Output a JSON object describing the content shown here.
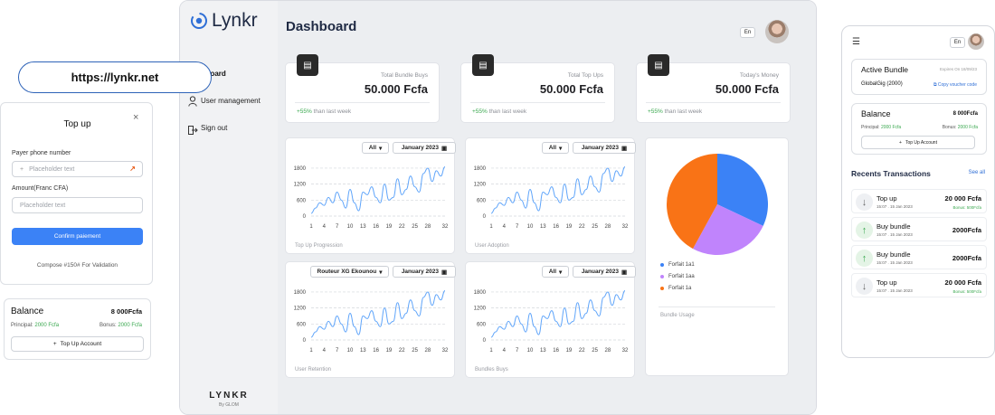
{
  "url_bar": {
    "text": "https://lynkr.net"
  },
  "topup_modal": {
    "title": "Top up",
    "phone_label": "Payer phone number",
    "phone_placeholder": "Placeholder text",
    "amount_label": "Amount(Franc CFA)",
    "amount_placeholder": "Placeholder text",
    "confirm_label": "Confirm paiement",
    "footer_text": "Compose #150# For Validation"
  },
  "left_balance": {
    "title": "Balance",
    "amount": "8 000Fcfa",
    "principal_label": "Principal:",
    "principal_value": "2000 Fcfa",
    "bonus_label": "Bonus:",
    "bonus_value": "2000 Fcfa",
    "topup_button": "Top Up Account"
  },
  "dashboard": {
    "logo": "Lynkr",
    "title": "Dashboard",
    "lang": "En",
    "nav": [
      {
        "label": "Dashboard"
      },
      {
        "label": "User management"
      },
      {
        "label": "Sign out"
      }
    ],
    "footer_brand": "LYNKR",
    "footer_sub": "By GLOM",
    "stats": [
      {
        "label": "Total Bundle Buys",
        "value": "50.000 Fcfa",
        "delta": "+55%",
        "delta_text": "than last week"
      },
      {
        "label": "Total Top Ups",
        "value": "50.000 Fcfa",
        "delta": "+55%",
        "delta_text": "than last week"
      },
      {
        "label": "Today's Money",
        "value": "50.000 Fcfa",
        "delta": "+55%",
        "delta_text": "than last week"
      }
    ],
    "charts_ui": [
      {
        "filter": "All",
        "date": "January 2023",
        "caption": "Top Up Progression"
      },
      {
        "filter": "All",
        "date": "January 2023",
        "caption": "User Adoption"
      },
      {
        "filter": "Routeur XG Ekounou",
        "date": "January 2023",
        "caption": "User Retention"
      },
      {
        "filter": "All",
        "date": "January 2023",
        "caption": "Bundles Buys"
      }
    ],
    "pie_ui": {
      "caption": "Bundle Usage"
    }
  },
  "chart_data": [
    {
      "type": "line",
      "title": "Top Up Progression",
      "x": [
        1,
        2,
        3,
        4,
        5,
        6,
        7,
        8,
        9,
        10,
        11,
        12,
        13,
        14,
        15,
        16,
        17,
        18,
        19,
        20,
        21,
        22,
        23,
        24,
        25,
        26,
        27,
        28,
        29,
        30,
        31,
        32
      ],
      "y": [
        100,
        300,
        500,
        400,
        700,
        500,
        900,
        600,
        300,
        1000,
        500,
        200,
        900,
        800,
        1100,
        700,
        500,
        1200,
        600,
        700,
        1400,
        800,
        1000,
        1500,
        1100,
        900,
        1600,
        1800,
        1300,
        1700,
        1500,
        1850
      ],
      "xticks": [
        1,
        4,
        7,
        10,
        13,
        16,
        19,
        22,
        25,
        28,
        32
      ],
      "yticks": [
        0,
        600,
        1200,
        1800
      ],
      "ylim": [
        0,
        1900
      ]
    },
    {
      "type": "line",
      "title": "User Adoption",
      "x": [
        1,
        2,
        3,
        4,
        5,
        6,
        7,
        8,
        9,
        10,
        11,
        12,
        13,
        14,
        15,
        16,
        17,
        18,
        19,
        20,
        21,
        22,
        23,
        24,
        25,
        26,
        27,
        28,
        29,
        30,
        31,
        32
      ],
      "y": [
        100,
        300,
        500,
        400,
        700,
        500,
        900,
        600,
        300,
        1000,
        500,
        200,
        900,
        800,
        1100,
        700,
        500,
        1200,
        600,
        700,
        1400,
        800,
        1000,
        1500,
        1100,
        900,
        1600,
        1800,
        1300,
        1700,
        1500,
        1850
      ],
      "xticks": [
        1,
        4,
        7,
        10,
        13,
        16,
        19,
        22,
        25,
        28,
        32
      ],
      "yticks": [
        0,
        600,
        1200,
        1800
      ],
      "ylim": [
        0,
        1900
      ]
    },
    {
      "type": "line",
      "title": "User Retention",
      "x": [
        1,
        2,
        3,
        4,
        5,
        6,
        7,
        8,
        9,
        10,
        11,
        12,
        13,
        14,
        15,
        16,
        17,
        18,
        19,
        20,
        21,
        22,
        23,
        24,
        25,
        26,
        27,
        28,
        29,
        30,
        31,
        32
      ],
      "y": [
        100,
        300,
        500,
        400,
        700,
        500,
        900,
        600,
        300,
        1000,
        500,
        200,
        900,
        800,
        1100,
        700,
        500,
        1200,
        600,
        700,
        1400,
        800,
        1000,
        1500,
        1100,
        900,
        1600,
        1800,
        1300,
        1700,
        1500,
        1850
      ],
      "xticks": [
        1,
        4,
        7,
        10,
        13,
        16,
        19,
        22,
        25,
        28,
        32
      ],
      "yticks": [
        0,
        600,
        1200,
        1800
      ],
      "ylim": [
        0,
        1900
      ]
    },
    {
      "type": "line",
      "title": "Bundles Buys",
      "x": [
        1,
        2,
        3,
        4,
        5,
        6,
        7,
        8,
        9,
        10,
        11,
        12,
        13,
        14,
        15,
        16,
        17,
        18,
        19,
        20,
        21,
        22,
        23,
        24,
        25,
        26,
        27,
        28,
        29,
        30,
        31,
        32
      ],
      "y": [
        100,
        300,
        500,
        400,
        700,
        500,
        900,
        600,
        300,
        1000,
        500,
        200,
        900,
        800,
        1100,
        700,
        500,
        1200,
        600,
        700,
        1400,
        800,
        1000,
        1500,
        1100,
        900,
        1600,
        1800,
        1300,
        1700,
        1500,
        1850
      ],
      "xticks": [
        1,
        4,
        7,
        10,
        13,
        16,
        19,
        22,
        25,
        28,
        32
      ],
      "yticks": [
        0,
        600,
        1200,
        1800
      ],
      "ylim": [
        0,
        1900
      ]
    },
    {
      "type": "pie",
      "title": "Bundle Usage",
      "categories": [
        "Forfait 1a1",
        "Forfait 1aa",
        "Forfait 1a"
      ],
      "values": [
        32,
        26,
        42
      ],
      "colors": [
        "#3b82f6",
        "#c084fc",
        "#f97316"
      ]
    }
  ],
  "phone": {
    "lang": "En",
    "active_bundle": {
      "title": "Active Bundle",
      "expires": "Expires On 18/09/23",
      "name": "GlobalGig (2000)",
      "copy_label": "Copy voucher code"
    },
    "balance": {
      "title": "Balance",
      "amount": "8 000Fcfa",
      "principal_label": "Principal:",
      "principal_value": "2000 Fcfa",
      "bonus_label": "Bonus:",
      "bonus_value": "2000 Fcfa",
      "topup_button": "Top Up Account"
    },
    "recents_title": "Recents Transactions",
    "see_all": "See all",
    "transactions": [
      {
        "title": "Top up",
        "date": "15:07 . 15 Jan 2023",
        "amount": "20 000 Fcfa",
        "bonus": "Bonus: 500Fcfa",
        "direction": "down"
      },
      {
        "title": "Buy bundle",
        "date": "15:07 . 15 Jan 2023",
        "amount": "2000Fcfa",
        "bonus": "",
        "direction": "up"
      },
      {
        "title": "Buy bundle",
        "date": "15:07 . 15 Jan 2023",
        "amount": "2000Fcfa",
        "bonus": "",
        "direction": "up"
      },
      {
        "title": "Top up",
        "date": "15:07 . 15 Jan 2023",
        "amount": "20 000 Fcfa",
        "bonus": "Bonus: 500Fcfa",
        "direction": "down"
      }
    ]
  }
}
